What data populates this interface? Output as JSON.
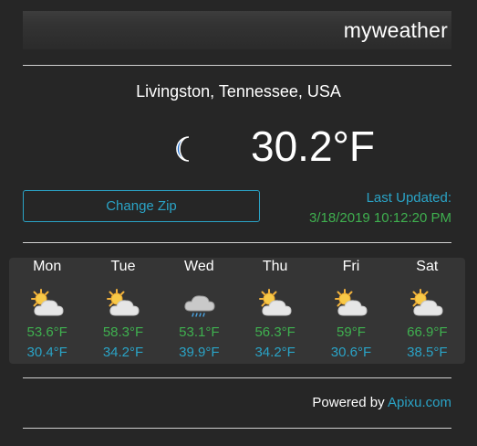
{
  "app": {
    "title": "myweather"
  },
  "current": {
    "location": "Livingston, Tennessee, USA",
    "temperature": "30.2°F",
    "icon": "moon-icon"
  },
  "controls": {
    "change_zip_label": "Change Zip"
  },
  "last_updated": {
    "label": "Last Updated:",
    "value": "3/18/2019 10:12:20 PM"
  },
  "forecast": [
    {
      "day": "Mon",
      "icon": "partly-cloudy-icon",
      "high": "53.6°F",
      "low": "30.4°F"
    },
    {
      "day": "Tue",
      "icon": "partly-cloudy-icon",
      "high": "58.3°F",
      "low": "34.2°F"
    },
    {
      "day": "Wed",
      "icon": "rain-cloud-icon",
      "high": "53.1°F",
      "low": "39.9°F"
    },
    {
      "day": "Thu",
      "icon": "partly-cloudy-icon",
      "high": "56.3°F",
      "low": "34.2°F"
    },
    {
      "day": "Fri",
      "icon": "partly-cloudy-icon",
      "high": "59°F",
      "low": "30.6°F"
    },
    {
      "day": "Sat",
      "icon": "partly-cloudy-icon",
      "high": "66.9°F",
      "low": "38.5°F"
    }
  ],
  "footer": {
    "powered_by": "Powered by",
    "provider": "Apixu.com"
  },
  "colors": {
    "background": "#262626",
    "accent_blue": "#2aa3c6",
    "accent_green": "#3fb04f",
    "panel": "#353535"
  }
}
